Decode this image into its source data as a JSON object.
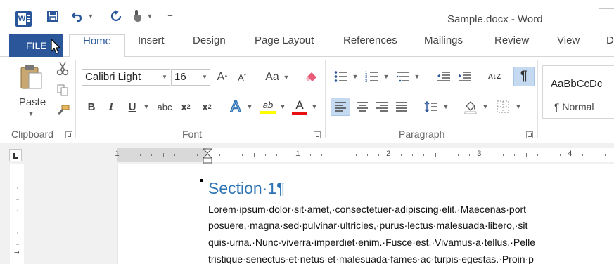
{
  "title_bar": {
    "app_icon": "W",
    "title": "Sample.docx - Word",
    "quick_access": {
      "save_icon": "save-icon",
      "undo_icon": "undo-icon",
      "redo_icon": "redo-icon",
      "touch_icon": "touch-mode-icon",
      "customize": "="
    }
  },
  "tabs": {
    "file": "FILE",
    "items": [
      "Home",
      "Insert",
      "Design",
      "Page Layout",
      "References",
      "Mailings",
      "Review",
      "View",
      "D"
    ],
    "active": "Home"
  },
  "ribbon": {
    "clipboard": {
      "label": "Clipboard",
      "paste": "Paste",
      "cut_icon": "scissors-icon",
      "copy_icon": "copy-icon",
      "format_painter_icon": "format-painter-icon"
    },
    "font": {
      "label": "Font",
      "font_name": "Calibri Light",
      "font_size": "16",
      "grow": "A",
      "shrink": "A",
      "change_case": "Aa",
      "bold": "B",
      "italic": "I",
      "underline": "U",
      "strikethrough": "abc",
      "subscript": "x",
      "subscript_mark": "2",
      "superscript": "x",
      "superscript_mark": "2",
      "text_effects": "A",
      "highlight": "ab",
      "font_color": "A"
    },
    "paragraph": {
      "label": "Paragraph",
      "sort": "A↓Z",
      "show_marks": "¶"
    },
    "styles": {
      "preview": "AaBbCcDc",
      "normal": "¶ Normal"
    }
  },
  "ruler": {
    "numbers": [
      "1",
      "1",
      "2",
      "3",
      "4"
    ]
  },
  "document": {
    "heading": "Section·1",
    "heading_mark": "¶",
    "lines": [
      "Lorem·ipsum·dolor·sit·amet,·consectetuer·adipiscing·elit.·Maecenas·port",
      "posuere,·magna·sed·pulvinar·ultricies,·purus·lectus·malesuada·libero,·sit",
      "quis·urna.·Nunc·viverra·imperdiet·enim.·Fusce·est.·Vivamus·a·tellus.·Pelle",
      "tristique·senectus·et·netus·et·malesuada·fames·ac·turpis·egestas.·Proin·p"
    ]
  },
  "colors": {
    "brand_blue": "#2b579a",
    "heading_blue": "#2e74b5",
    "selected_button": "#c5daf0"
  }
}
